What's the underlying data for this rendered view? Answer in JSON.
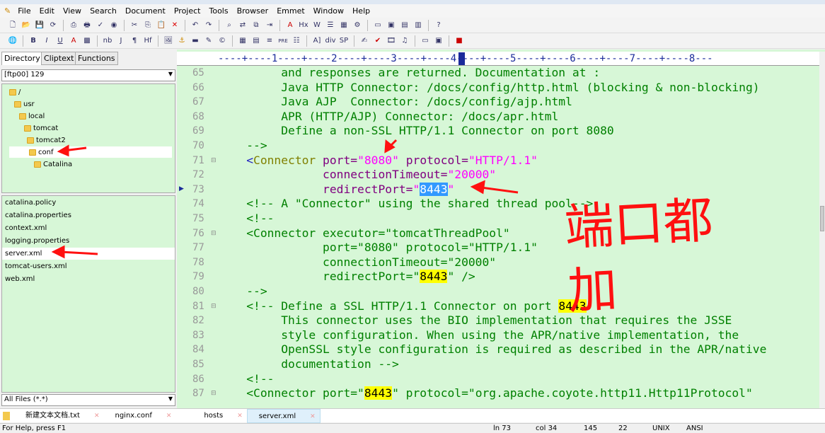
{
  "menu": [
    "File",
    "Edit",
    "View",
    "Search",
    "Document",
    "Project",
    "Tools",
    "Browser",
    "Emmet",
    "Window",
    "Help"
  ],
  "toolbar2_text": [
    "B",
    "I",
    "U",
    "A",
    "nb",
    "J",
    "¶",
    "Hf",
    "PRE",
    "div",
    "SP"
  ],
  "left_panel": {
    "tabs": [
      "Directory",
      "Cliptext",
      "Functions"
    ],
    "drive": "[ftp00] 129",
    "tree": [
      "/",
      "usr",
      "local",
      "tomcat",
      "tomcat2",
      "conf",
      "Catalina"
    ],
    "files": [
      "catalina.policy",
      "catalina.properties",
      "context.xml",
      "logging.properties",
      "server.xml",
      "tomcat-users.xml",
      "web.xml"
    ],
    "filter": "All Files (*.*)"
  },
  "ruler": "----+----1----+----2----+----3----+----4----+----5----+----6----+----7----+----8---",
  "lines": [
    {
      "n": "65",
      "text": "         and responses are returned. Documentation at :"
    },
    {
      "n": "66",
      "text": "         Java HTTP Connector: /docs/config/http.html (blocking & non-blocking)"
    },
    {
      "n": "67",
      "text": "         Java AJP  Connector: /docs/config/ajp.html"
    },
    {
      "n": "68",
      "text": "         APR (HTTP/AJP) Connector: /docs/apr.html"
    },
    {
      "n": "69",
      "text": "         Define a non-SSL HTTP/1.1 Connector on port 8080"
    },
    {
      "n": "70",
      "text": "    -->"
    },
    {
      "n": "71"
    },
    {
      "n": "72"
    },
    {
      "n": "73"
    },
    {
      "n": "74",
      "text": "    <!-- A \"Connector\" using the shared thread pool-->"
    },
    {
      "n": "75",
      "text": "    <!--"
    },
    {
      "n": "76",
      "text": "    <Connector executor=\"tomcatThreadPool\""
    },
    {
      "n": "77",
      "text": "               port=\"8080\" protocol=\"HTTP/1.1\""
    },
    {
      "n": "78",
      "text": "               connectionTimeout=\"20000\""
    },
    {
      "n": "79a",
      "text": "               redirectPort=\""
    },
    {
      "n": "79b",
      "text": "8443"
    },
    {
      "n": "79c",
      "text": "\" />"
    },
    {
      "n": "80",
      "text": "    -->"
    },
    {
      "n": "81a",
      "text": "    <!-- Define a SSL HTTP/1.1 Connector on port "
    },
    {
      "n": "81b",
      "text": "8443"
    },
    {
      "n": "82",
      "text": "         This connector uses the BIO implementation that requires the JSSE"
    },
    {
      "n": "83",
      "text": "         style configuration. When using the APR/native implementation, the"
    },
    {
      "n": "84",
      "text": "         OpenSSL style configuration is required as described in the APR/native"
    },
    {
      "n": "85",
      "text": "         documentation -->"
    },
    {
      "n": "86",
      "text": "    <!--"
    },
    {
      "n": "87a",
      "text": "    <Connector port=\""
    },
    {
      "n": "87b",
      "text": "8443"
    },
    {
      "n": "87c",
      "text": "\" protocol=\"org.apache.coyote.http11.Http11Protocol\""
    }
  ],
  "line71": {
    "lt": "    <",
    "tag": "Connector",
    "a1": " port=",
    "v1": "\"8080\"",
    "a2": " protocol=",
    "v2": "\"HTTP/1.1\""
  },
  "line72": {
    "a": "               connectionTimeout=",
    "v": "\"20000\""
  },
  "line73": {
    "a": "               redirectPort=",
    "q1": "\"",
    "sel": "8443",
    "q2": "\""
  },
  "annotation": "端口都加",
  "doc_tabs": [
    "新建文本文档.txt",
    "nginx.conf",
    "hosts",
    "server.xml"
  ],
  "status": {
    "help": "For Help, press F1",
    "ln": "ln 73",
    "col": "col 34",
    "n1": "145",
    "n2": "22",
    "eol": "UNIX",
    "enc": "ANSI"
  },
  "colors": {
    "editor_bg": "#d7f7d7",
    "comment": "#008000",
    "attr": "#800080",
    "value": "#ff00ff",
    "highlight": "#ffff00",
    "arrow": "#ff1010"
  }
}
